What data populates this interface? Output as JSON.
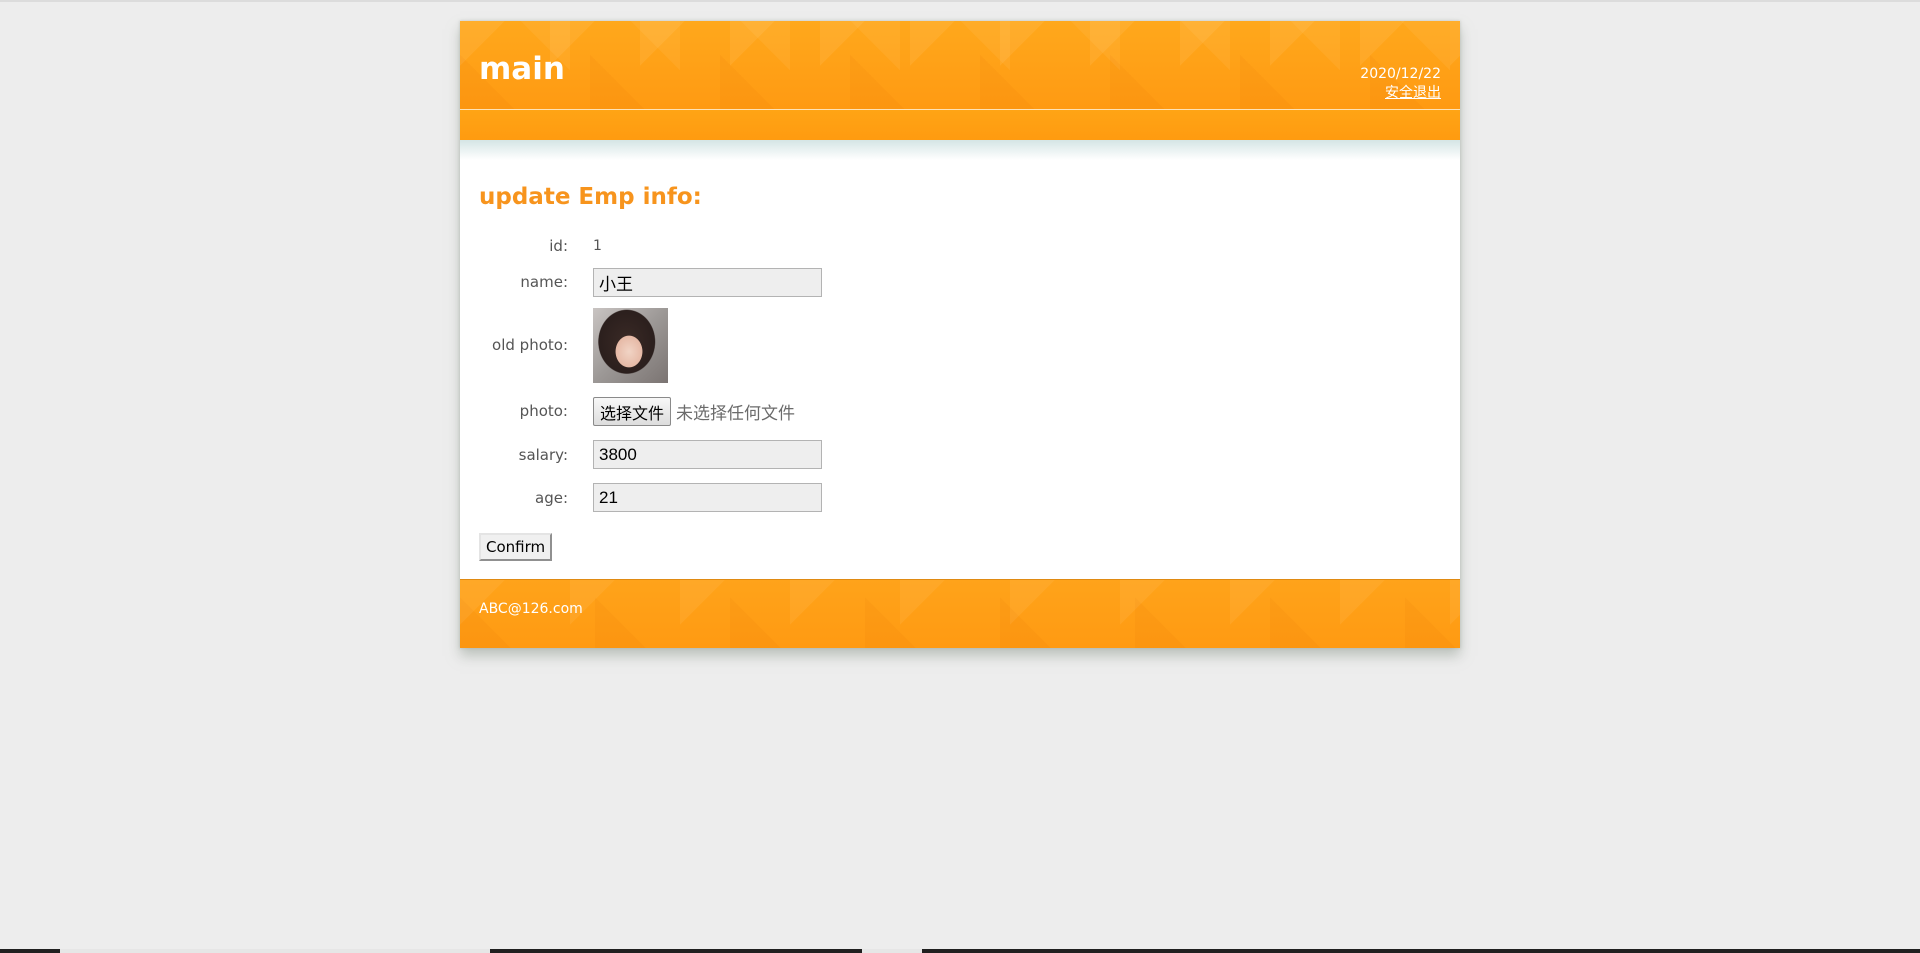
{
  "header": {
    "logo": "main",
    "date": "2020/12/22",
    "logout_link": "安全退出"
  },
  "main": {
    "title": "update Emp info:",
    "fields": {
      "id_label": "id:",
      "id_value": "1",
      "name_label": "name:",
      "name_value": "小王",
      "old_photo_label": "old photo:",
      "photo_label": "photo:",
      "file_button": "选择文件",
      "file_status": "未选择任何文件",
      "salary_label": "salary:",
      "salary_value": "3800",
      "age_label": "age:",
      "age_value": "21"
    },
    "confirm_button": "Confirm"
  },
  "footer": {
    "email": "ABC@126.com"
  },
  "colors": {
    "accent": "#f7941d",
    "header_orange": "#ff9a12",
    "page_bg": "#ededed"
  }
}
